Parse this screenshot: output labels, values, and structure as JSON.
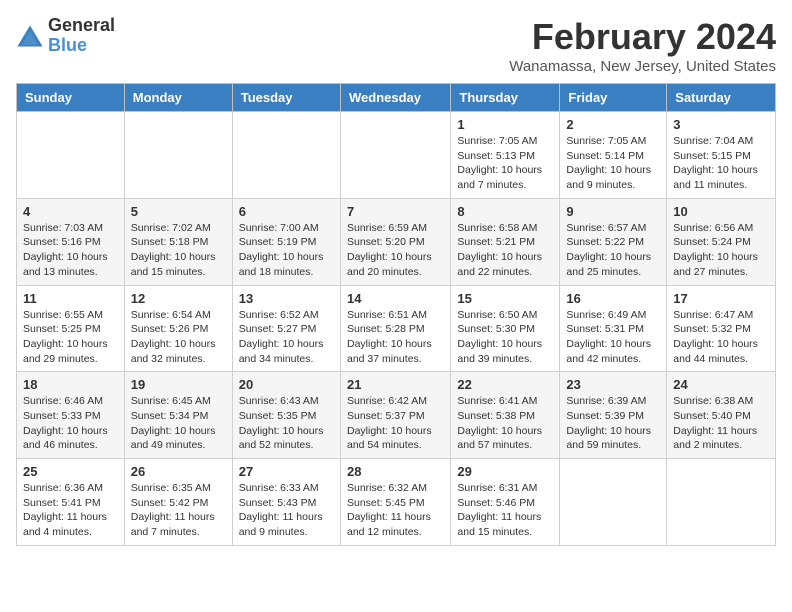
{
  "header": {
    "logo_general": "General",
    "logo_blue": "Blue",
    "month_title": "February 2024",
    "location": "Wanamassa, New Jersey, United States"
  },
  "days_of_week": [
    "Sunday",
    "Monday",
    "Tuesday",
    "Wednesday",
    "Thursday",
    "Friday",
    "Saturday"
  ],
  "weeks": [
    [
      {
        "day": "",
        "info": ""
      },
      {
        "day": "",
        "info": ""
      },
      {
        "day": "",
        "info": ""
      },
      {
        "day": "",
        "info": ""
      },
      {
        "day": "1",
        "info": "Sunrise: 7:05 AM\nSunset: 5:13 PM\nDaylight: 10 hours\nand 7 minutes."
      },
      {
        "day": "2",
        "info": "Sunrise: 7:05 AM\nSunset: 5:14 PM\nDaylight: 10 hours\nand 9 minutes."
      },
      {
        "day": "3",
        "info": "Sunrise: 7:04 AM\nSunset: 5:15 PM\nDaylight: 10 hours\nand 11 minutes."
      }
    ],
    [
      {
        "day": "4",
        "info": "Sunrise: 7:03 AM\nSunset: 5:16 PM\nDaylight: 10 hours\nand 13 minutes."
      },
      {
        "day": "5",
        "info": "Sunrise: 7:02 AM\nSunset: 5:18 PM\nDaylight: 10 hours\nand 15 minutes."
      },
      {
        "day": "6",
        "info": "Sunrise: 7:00 AM\nSunset: 5:19 PM\nDaylight: 10 hours\nand 18 minutes."
      },
      {
        "day": "7",
        "info": "Sunrise: 6:59 AM\nSunset: 5:20 PM\nDaylight: 10 hours\nand 20 minutes."
      },
      {
        "day": "8",
        "info": "Sunrise: 6:58 AM\nSunset: 5:21 PM\nDaylight: 10 hours\nand 22 minutes."
      },
      {
        "day": "9",
        "info": "Sunrise: 6:57 AM\nSunset: 5:22 PM\nDaylight: 10 hours\nand 25 minutes."
      },
      {
        "day": "10",
        "info": "Sunrise: 6:56 AM\nSunset: 5:24 PM\nDaylight: 10 hours\nand 27 minutes."
      }
    ],
    [
      {
        "day": "11",
        "info": "Sunrise: 6:55 AM\nSunset: 5:25 PM\nDaylight: 10 hours\nand 29 minutes."
      },
      {
        "day": "12",
        "info": "Sunrise: 6:54 AM\nSunset: 5:26 PM\nDaylight: 10 hours\nand 32 minutes."
      },
      {
        "day": "13",
        "info": "Sunrise: 6:52 AM\nSunset: 5:27 PM\nDaylight: 10 hours\nand 34 minutes."
      },
      {
        "day": "14",
        "info": "Sunrise: 6:51 AM\nSunset: 5:28 PM\nDaylight: 10 hours\nand 37 minutes."
      },
      {
        "day": "15",
        "info": "Sunrise: 6:50 AM\nSunset: 5:30 PM\nDaylight: 10 hours\nand 39 minutes."
      },
      {
        "day": "16",
        "info": "Sunrise: 6:49 AM\nSunset: 5:31 PM\nDaylight: 10 hours\nand 42 minutes."
      },
      {
        "day": "17",
        "info": "Sunrise: 6:47 AM\nSunset: 5:32 PM\nDaylight: 10 hours\nand 44 minutes."
      }
    ],
    [
      {
        "day": "18",
        "info": "Sunrise: 6:46 AM\nSunset: 5:33 PM\nDaylight: 10 hours\nand 46 minutes."
      },
      {
        "day": "19",
        "info": "Sunrise: 6:45 AM\nSunset: 5:34 PM\nDaylight: 10 hours\nand 49 minutes."
      },
      {
        "day": "20",
        "info": "Sunrise: 6:43 AM\nSunset: 5:35 PM\nDaylight: 10 hours\nand 52 minutes."
      },
      {
        "day": "21",
        "info": "Sunrise: 6:42 AM\nSunset: 5:37 PM\nDaylight: 10 hours\nand 54 minutes."
      },
      {
        "day": "22",
        "info": "Sunrise: 6:41 AM\nSunset: 5:38 PM\nDaylight: 10 hours\nand 57 minutes."
      },
      {
        "day": "23",
        "info": "Sunrise: 6:39 AM\nSunset: 5:39 PM\nDaylight: 10 hours\nand 59 minutes."
      },
      {
        "day": "24",
        "info": "Sunrise: 6:38 AM\nSunset: 5:40 PM\nDaylight: 11 hours\nand 2 minutes."
      }
    ],
    [
      {
        "day": "25",
        "info": "Sunrise: 6:36 AM\nSunset: 5:41 PM\nDaylight: 11 hours\nand 4 minutes."
      },
      {
        "day": "26",
        "info": "Sunrise: 6:35 AM\nSunset: 5:42 PM\nDaylight: 11 hours\nand 7 minutes."
      },
      {
        "day": "27",
        "info": "Sunrise: 6:33 AM\nSunset: 5:43 PM\nDaylight: 11 hours\nand 9 minutes."
      },
      {
        "day": "28",
        "info": "Sunrise: 6:32 AM\nSunset: 5:45 PM\nDaylight: 11 hours\nand 12 minutes."
      },
      {
        "day": "29",
        "info": "Sunrise: 6:31 AM\nSunset: 5:46 PM\nDaylight: 11 hours\nand 15 minutes."
      },
      {
        "day": "",
        "info": ""
      },
      {
        "day": "",
        "info": ""
      }
    ]
  ]
}
